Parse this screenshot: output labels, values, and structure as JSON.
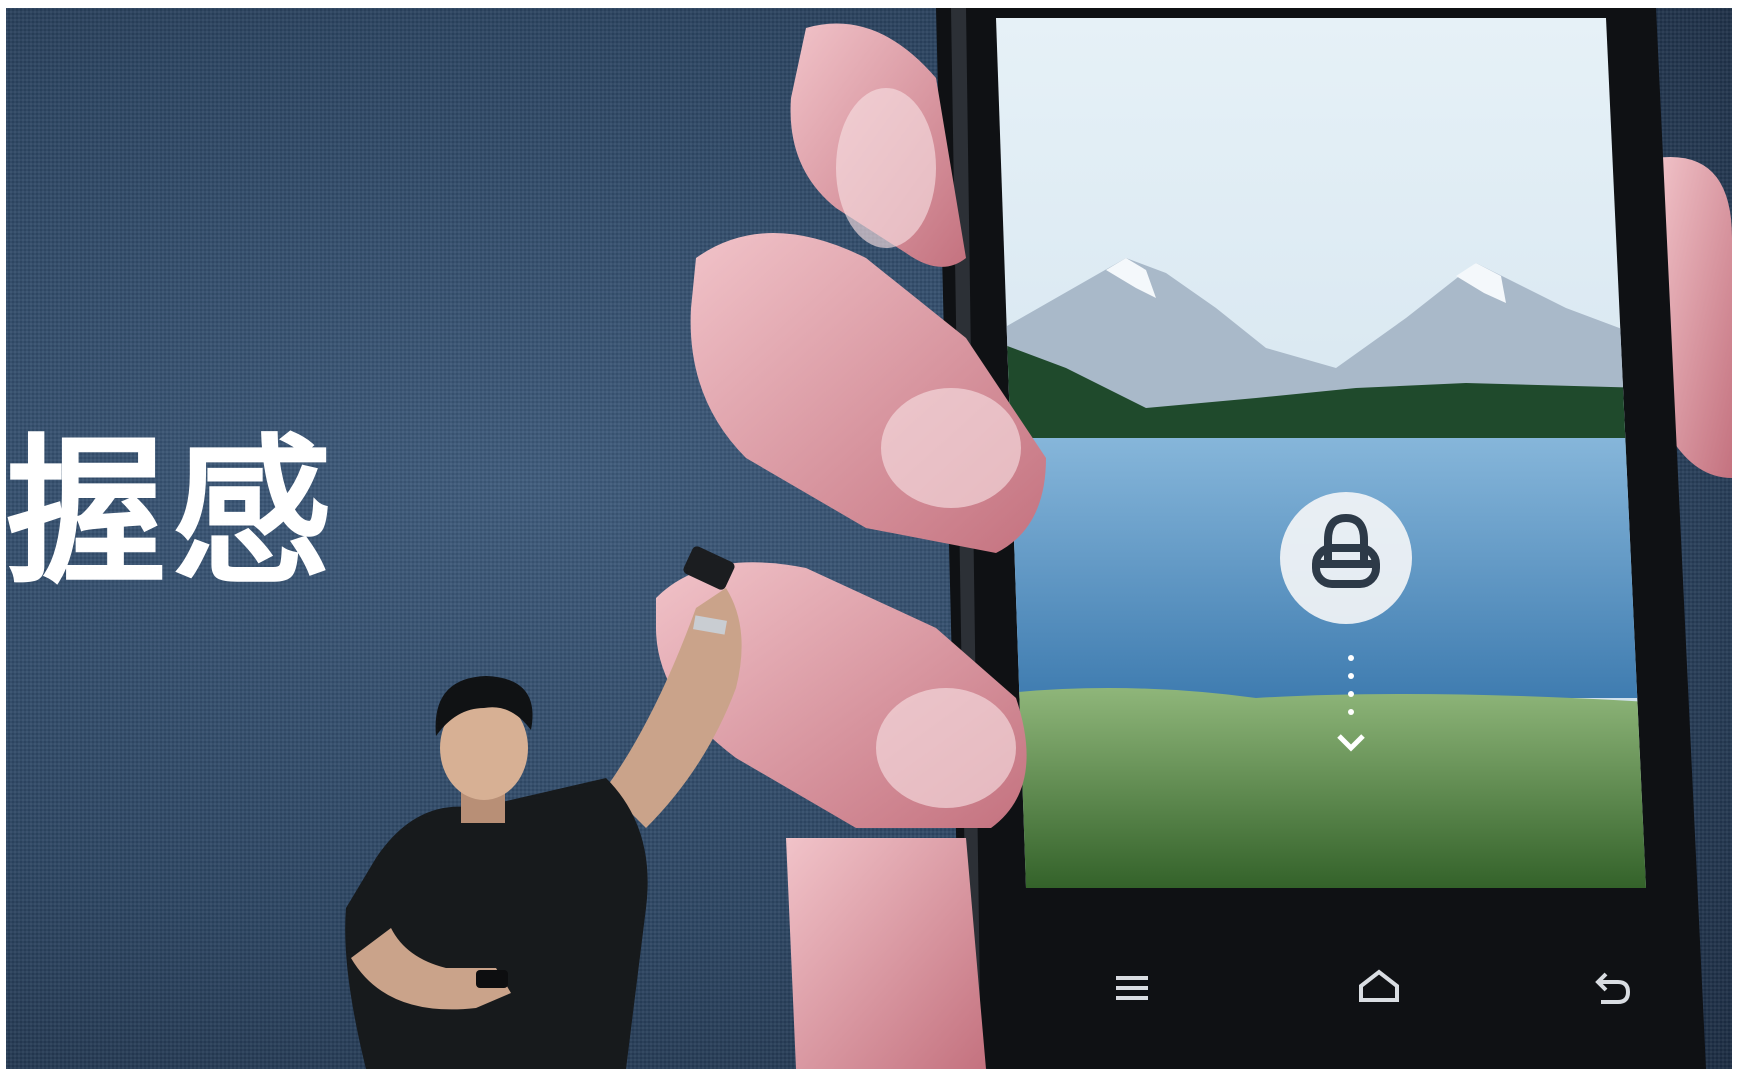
{
  "slide": {
    "headline": "握感"
  },
  "phone": {
    "lock_icon": "lock-icon",
    "swipe_hint_icon": "chevron-down-icon",
    "nav_icons": [
      "menu-icon",
      "home-icon",
      "back-icon"
    ]
  },
  "colors": {
    "backdrop": "#2c4562",
    "phone_body": "#0f1114",
    "sky": "#d7e8f3",
    "lake": "#5f98c7",
    "grass": "#4f8a3c",
    "skin": "#d99aa2"
  }
}
